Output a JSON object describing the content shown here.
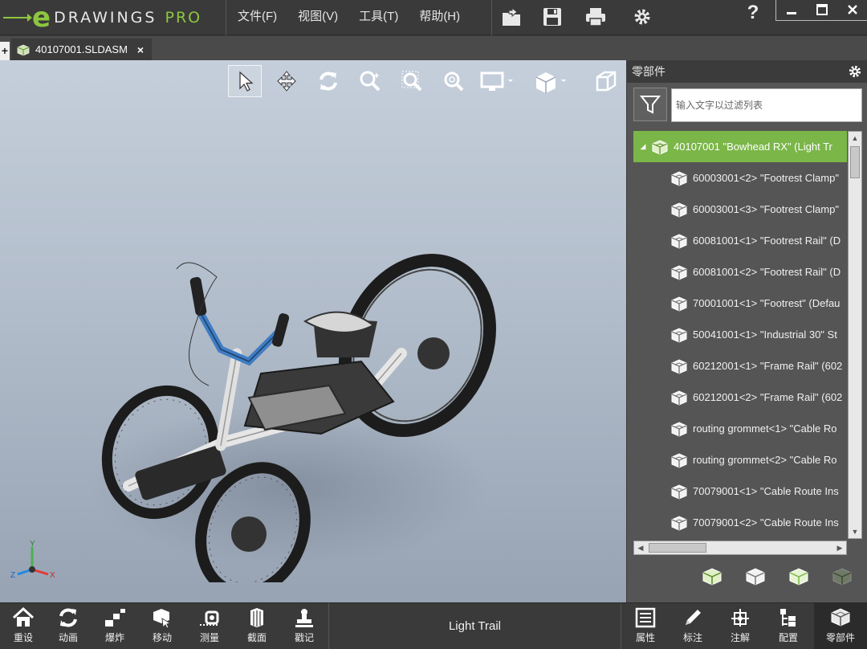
{
  "app": {
    "logo_letter": "e",
    "logo_brand": "DRAWINGS",
    "logo_edition": "PRO",
    "menu": [
      {
        "label": "文件(F)"
      },
      {
        "label": "视图(V)"
      },
      {
        "label": "工具(T)"
      },
      {
        "label": "帮助(H)"
      }
    ],
    "toolbar_icons": [
      "open-icon",
      "save-icon",
      "print-icon",
      "settings-gear-icon"
    ],
    "help_label": "?",
    "window_buttons": [
      "minimize-icon",
      "maximize-icon",
      "close-icon"
    ]
  },
  "tabs": {
    "new_tab_label": "+",
    "document": {
      "name": "40107001.SLDASM",
      "close_label": "×"
    }
  },
  "view_toolbar": [
    "select-arrow-icon",
    "pan-icon",
    "rotate-icon",
    "zoom-to-fit-icon",
    "zoom-to-area-icon",
    "zoom-icon",
    "display-style-icon",
    "section-view-icon",
    "standard-views-icon"
  ],
  "triad": {
    "x": "X",
    "y": "Y",
    "z": "Z"
  },
  "panel": {
    "title": "零部件",
    "filter_placeholder": "输入文字以过滤列表",
    "tree": {
      "root": {
        "label": "40107001 \"Bowhead RX\" (Light Tr",
        "expanded": true
      },
      "children": [
        {
          "label": "60003001<2> \"Footrest Clamp\""
        },
        {
          "label": "60003001<3> \"Footrest Clamp\""
        },
        {
          "label": "60081001<1> \"Footrest Rail\" (D"
        },
        {
          "label": "60081001<2> \"Footrest Rail\" (D"
        },
        {
          "label": "70001001<1> \"Footrest\" (Defau"
        },
        {
          "label": "50041001<1> \"Industrial 30\" St"
        },
        {
          "label": "60212001<1> \"Frame Rail\" (602"
        },
        {
          "label": "60212001<2> \"Frame Rail\" (602"
        },
        {
          "label": "routing grommet<1> \"Cable Ro"
        },
        {
          "label": "routing grommet<2> \"Cable Ro"
        },
        {
          "label": "70079001<1> \"Cable Route Ins"
        },
        {
          "label": "70079001<2> \"Cable Route Ins"
        }
      ]
    },
    "action_icons": [
      "show-all-icon",
      "hide-icon",
      "isolate-icon",
      "transparency-icon"
    ]
  },
  "bottom_bar": {
    "left": [
      {
        "label": "重设",
        "icon": "home-icon"
      },
      {
        "label": "动画",
        "icon": "animate-icon"
      },
      {
        "label": "爆炸",
        "icon": "explode-icon"
      },
      {
        "label": "移动",
        "icon": "move-icon"
      },
      {
        "label": "测量",
        "icon": "measure-icon"
      },
      {
        "label": "截面",
        "icon": "section-icon"
      },
      {
        "label": "戳记",
        "icon": "stamp-icon"
      }
    ],
    "configuration": "Light Trail",
    "right": [
      {
        "label": "属性",
        "icon": "properties-icon"
      },
      {
        "label": "标注",
        "icon": "markup-pencil-icon"
      },
      {
        "label": "注解",
        "icon": "annotation-icon"
      },
      {
        "label": "配置",
        "icon": "configurations-icon"
      },
      {
        "label": "零部件",
        "icon": "components-icon",
        "active": true
      }
    ]
  },
  "colors": {
    "accent_green": "#7ab648",
    "dark_bg": "#3a3a3a",
    "panel_bg": "#555555"
  }
}
